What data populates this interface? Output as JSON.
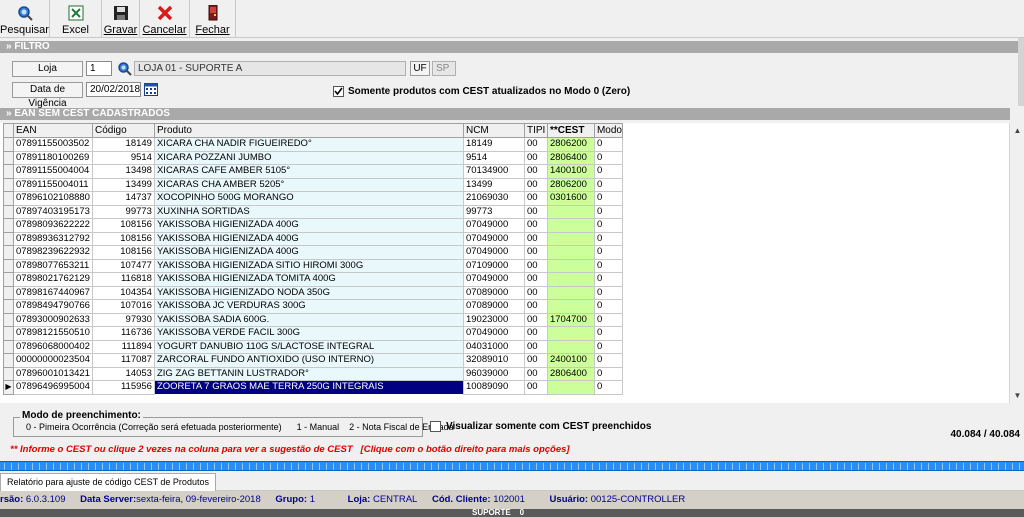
{
  "toolbar": [
    {
      "label": "Pesquisar",
      "icon": "search-icon"
    },
    {
      "label": "Excel",
      "icon": "excel-icon"
    },
    {
      "label": "Gravar",
      "icon": "save-icon"
    },
    {
      "label": "Cancelar",
      "icon": "cancel-icon"
    },
    {
      "label": "Fechar",
      "icon": "close-door-icon"
    }
  ],
  "filter": {
    "header": "» FILTRO",
    "loja_label": "Loja",
    "loja_code": "1",
    "loja_name": "LOJA 01 - SUPORTE A",
    "uf_label": "UF",
    "uf_value": "SP",
    "vigencia_label": "Data de Vigência",
    "vigencia_value": "20/02/2018",
    "checkbox_label": "Somente produtos com CEST atualizados no Modo 0 (Zero)",
    "checkbox_checked": true
  },
  "grid": {
    "header": "» EAN SEM CEST CADASTRADOS",
    "columns": [
      "EAN",
      "Código",
      "Produto",
      "NCM",
      "TIPI",
      "**CEST",
      "Modo"
    ],
    "rows": [
      [
        "07891155003502",
        "18149",
        "XICARA CHA NADIR FIGUEIREDO°",
        "18149",
        "00",
        "2806200",
        "0"
      ],
      [
        "07891180100269",
        "9514",
        "XICARA POZZANI JUMBO",
        "9514",
        "00",
        "2806400",
        "0"
      ],
      [
        "07891155004004",
        "13498",
        "XICARAS CAFE AMBER 5105°",
        "70134900",
        "00",
        "1400100",
        "0"
      ],
      [
        "07891155004011",
        "13499",
        "XICARAS CHA AMBER 5205°",
        "13499",
        "00",
        "2806200",
        "0"
      ],
      [
        "07896102108880",
        "14737",
        "XOCOPINHO 500G MORANGO",
        "21069030",
        "00",
        "0301600",
        "0"
      ],
      [
        "07897403195173",
        "99773",
        "XUXINHA SORTIDAS",
        "99773",
        "00",
        "",
        "0"
      ],
      [
        "07898093622222",
        "108156",
        "YAKISSOBA HIGIENIZADA 400G",
        "07049000",
        "00",
        "",
        "0"
      ],
      [
        "07898936312792",
        "108156",
        "YAKISSOBA HIGIENIZADA 400G",
        "07049000",
        "00",
        "",
        "0"
      ],
      [
        "07898239622932",
        "108156",
        "YAKISSOBA HIGIENIZADA 400G",
        "07049000",
        "00",
        "",
        "0"
      ],
      [
        "07898077653211",
        "107477",
        "YAKISSOBA HIGIENIZADA SITIO HIROMI 300G",
        "07109000",
        "00",
        "",
        "0"
      ],
      [
        "07898021762129",
        "116818",
        "YAKISSOBA HIGIENIZADA TOMITA 400G",
        "07049000",
        "00",
        "",
        "0"
      ],
      [
        "07898167440967",
        "104354",
        "YAKISSOBA HIGIENIZADO NODA 350G",
        "07089000",
        "00",
        "",
        "0"
      ],
      [
        "07898494790766",
        "107016",
        "YAKISSOBA JC VERDURAS 300G",
        "07089000",
        "00",
        "",
        "0"
      ],
      [
        "07893000902633",
        "97930",
        "YAKISSOBA SADIA 600G.",
        "19023000",
        "00",
        "1704700",
        "0"
      ],
      [
        "07898121550510",
        "116736",
        "YAKISSOBA VERDE FACIL 300G",
        "07049000",
        "00",
        "",
        "0"
      ],
      [
        "07896068000402",
        "111894",
        "YOGURT DANUBIO 110G S/LACTOSE INTEGRAL",
        "04031000",
        "00",
        "",
        "0"
      ],
      [
        "00000000023504",
        "117087",
        "ZARCORAL FUNDO ANTIOXIDO (USO INTERNO)",
        "32089010",
        "00",
        "2400100",
        "0"
      ],
      [
        "07896001013421",
        "14053",
        "ZIG ZAG BETTANIN LUSTRADOR°",
        "96039000",
        "00",
        "2806400",
        "0"
      ],
      [
        "07896496995004",
        "115956",
        "ZOORETA 7 GRAOS MAE TERRA 250G INTEGRAIS",
        "10089090",
        "00",
        "",
        "0"
      ]
    ],
    "selected_row": 18
  },
  "legend": {
    "title": "Modo de preenchimento:",
    "text": "0 - Pimeira Ocorrência (Correção será efetuada posteriormente)      1 - Manual    2 - Nota Fiscal de Entrada"
  },
  "visualizar_label": "Visualizar somente com CEST preenchidos",
  "record_count": "40.084 / 40.084",
  "hint": "** Informe o CEST ou clique 2 vezes na coluna para ver a sugestão de CEST   [Clique com o botão direito para mais opções]",
  "tab_label": "Relatório para ajuste de código CEST de Produtos",
  "status": {
    "version_label": "rsão:",
    "version": "6.0.3.109",
    "server_label": "Data Server:",
    "server": "sexta-feira, 09-fevereiro-2018",
    "group_label": "Grupo:",
    "group": "1",
    "store_label": "Loja:",
    "store": "CENTRAL",
    "client_label": "Cód. Cliente:",
    "client": "102001",
    "user_label": "Usuário:",
    "user": "00125-CONTROLLER"
  },
  "bottom_text": "SUPORTE    0"
}
